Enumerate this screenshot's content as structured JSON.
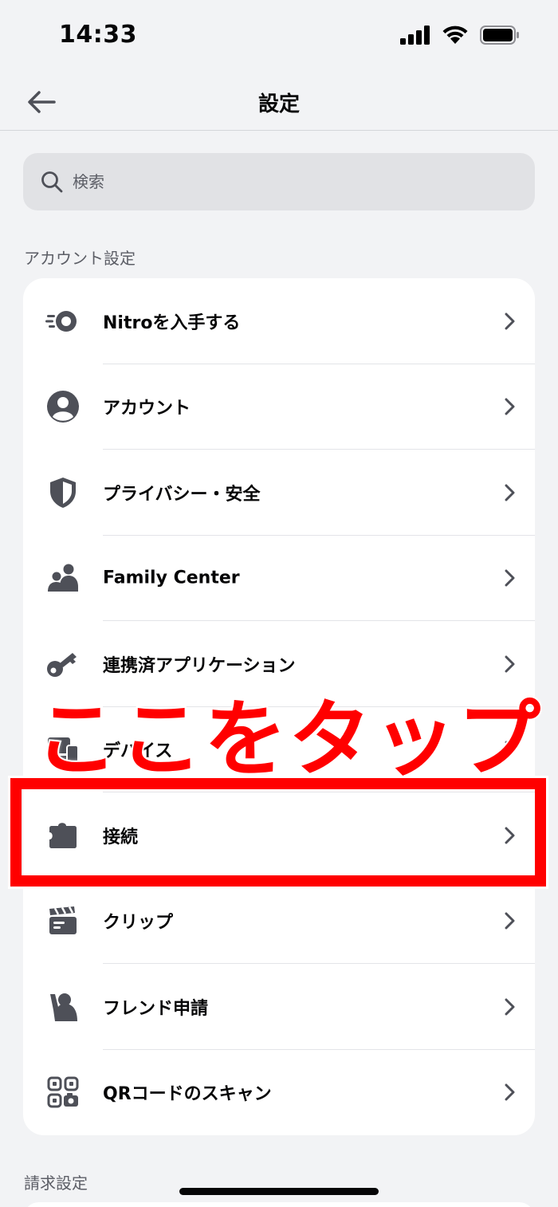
{
  "status_bar": {
    "time": "14:33"
  },
  "nav": {
    "title": "設定"
  },
  "search": {
    "placeholder": "検索"
  },
  "sections": {
    "account_header": "アカウント設定",
    "billing_header": "請求設定"
  },
  "account_items": [
    {
      "label": "Nitroを入手する",
      "icon": "nitro-icon"
    },
    {
      "label": "アカウント",
      "icon": "account-icon"
    },
    {
      "label": "プライバシー・安全",
      "icon": "shield-icon"
    },
    {
      "label": "Family Center",
      "icon": "family-icon"
    },
    {
      "label": "連携済アプリケーション",
      "icon": "key-icon"
    },
    {
      "label": "デバイス",
      "icon": "devices-icon"
    },
    {
      "label": "接続",
      "icon": "puzzle-icon"
    },
    {
      "label": "クリップ",
      "icon": "clapper-icon"
    },
    {
      "label": "フレンド申請",
      "icon": "friend-request-icon"
    },
    {
      "label": "QRコードのスキャン",
      "icon": "qr-scan-icon"
    }
  ],
  "annotation": {
    "text": "ここをタップ",
    "color": "#ff0000"
  },
  "colors": {
    "background": "#f2f3f5",
    "icon": "#4e5058",
    "card": "#ffffff"
  }
}
